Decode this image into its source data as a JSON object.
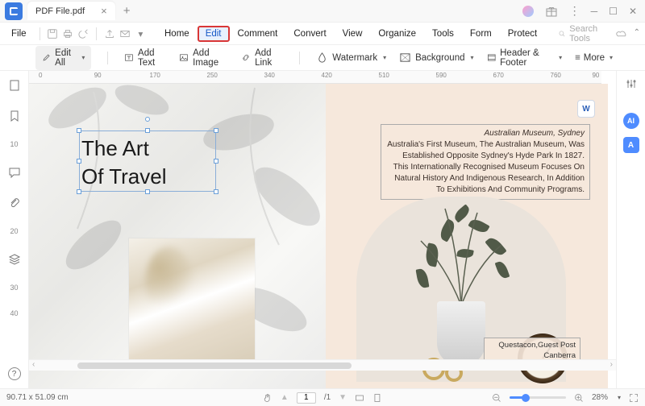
{
  "tab": {
    "title": "PDF File.pdf"
  },
  "menubar": {
    "file": "File",
    "items": [
      "Home",
      "Edit",
      "Comment",
      "Convert",
      "View",
      "Organize",
      "Tools",
      "Form",
      "Protect"
    ],
    "active_index": 1,
    "search_placeholder": "Search Tools"
  },
  "toolbar": {
    "edit_all": "Edit All",
    "add_text": "Add Text",
    "add_image": "Add Image",
    "add_link": "Add Link",
    "watermark": "Watermark",
    "background": "Background",
    "header_footer": "Header & Footer",
    "more": "More"
  },
  "ruler": {
    "marks": [
      "0",
      "90",
      "170",
      "250",
      "340",
      "420",
      "510",
      "590",
      "670",
      "760",
      "90"
    ]
  },
  "left_rail_nums": [
    "10",
    "20",
    "30",
    "40"
  ],
  "document": {
    "title_line1": "The Art",
    "title_line2": "Of Travel",
    "info_heading": "Australian Museum, Sydney",
    "info_body": "Australia's First Museum, The Australian Museum, Was Established Opposite Sydney's Hyde Park In 1827. This Internationally Recognised Museum Focuses On Natural History And Indigenous Research, In Addition To Exhibitions And Community Programs.",
    "caption_line1": "Questacon,Guest Post",
    "caption_line2": "Canberra"
  },
  "right_rail": {
    "ai": "AI",
    "a": "A"
  },
  "status": {
    "coords": "90.71 x 51.09 cm",
    "page_current": "1",
    "page_total": "/1",
    "zoom": "28%"
  },
  "word_badge": "W"
}
